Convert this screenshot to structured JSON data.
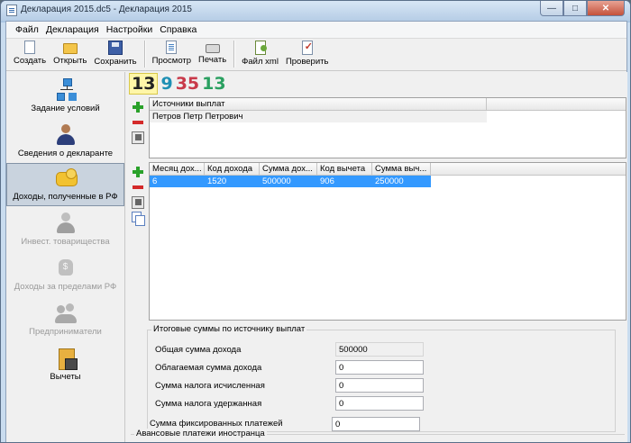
{
  "window": {
    "title": "Декларация 2015.dc5 - Декларация 2015",
    "min": "—",
    "max": "□",
    "close": "✕"
  },
  "menu": [
    "Файл",
    "Декларация",
    "Настройки",
    "Справка"
  ],
  "toolbar": {
    "create": "Создать",
    "open": "Открыть",
    "save": "Сохранить",
    "preview": "Просмотр",
    "print": "Печать",
    "xml": "Файл xml",
    "check": "Проверить"
  },
  "nav": [
    {
      "label": "Задание условий",
      "icon": "tree-icon",
      "enabled": true
    },
    {
      "label": "Сведения о декларанте",
      "icon": "person-icon",
      "enabled": true
    },
    {
      "label": "Доходы, полученные в РФ",
      "icon": "money-icon",
      "enabled": true,
      "active": true
    },
    {
      "label": "Инвест. товарищества",
      "icon": "investor-icon",
      "enabled": false
    },
    {
      "label": "Доходы за пределами РФ",
      "icon": "money-bag-icon",
      "enabled": false
    },
    {
      "label": "Предприниматели",
      "icon": "group-icon",
      "enabled": false
    },
    {
      "label": "Вычеты",
      "icon": "calculator-icon",
      "enabled": true
    }
  ],
  "counter": {
    "a": "13",
    "b": "9",
    "c": "35",
    "d": "13"
  },
  "sources": {
    "header": "Источники выплат",
    "rows": [
      "Петров Петр Петрович"
    ]
  },
  "income": {
    "headers": [
      "Месяц дох...",
      "Код дохода",
      "Сумма дох...",
      "Код вычета",
      "Сумма выч..."
    ],
    "rows": [
      [
        "6",
        "1520",
        "500000",
        "906",
        "250000"
      ]
    ]
  },
  "totals": {
    "legend": "Итоговые суммы по источнику выплат",
    "total_income_label": "Общая сумма дохода",
    "total_income": "500000",
    "taxable_label": "Облагаемая сумма дохода",
    "taxable": "0",
    "tax_calc_label": "Сумма налога исчисленная",
    "tax_calc": "0",
    "tax_withheld_label": "Сумма налога удержанная",
    "tax_withheld": "0"
  },
  "advance": {
    "legend": "Авансовые платежи иностранца",
    "fixed_label": "Сумма фиксированных платежей",
    "fixed": "0"
  }
}
